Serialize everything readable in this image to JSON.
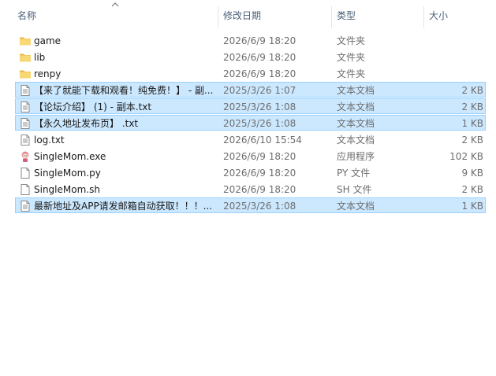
{
  "columns": {
    "name": "名称",
    "date": "修改日期",
    "type": "类型",
    "size": "大小"
  },
  "files": [
    {
      "name": "game",
      "date": "2026/6/9 18:20",
      "type": "文件夹",
      "size": "",
      "icon": "folder-icon",
      "selected": false
    },
    {
      "name": "lib",
      "date": "2026/6/9 18:20",
      "type": "文件夹",
      "size": "",
      "icon": "folder-icon",
      "selected": false
    },
    {
      "name": "renpy",
      "date": "2026/6/9 18:20",
      "type": "文件夹",
      "size": "",
      "icon": "folder-icon",
      "selected": false
    },
    {
      "name": "【来了就能下载和观看！纯免费！】 - 副...",
      "date": "2025/3/26 1:07",
      "type": "文本文档",
      "size": "2 KB",
      "icon": "text-file-icon",
      "selected": true
    },
    {
      "name": "【论坛介绍】 (1) - 副本.txt",
      "date": "2025/3/26 1:08",
      "type": "文本文档",
      "size": "2 KB",
      "icon": "text-file-icon",
      "selected": true
    },
    {
      "name": "【永久地址发布页】 .txt",
      "date": "2025/3/26 1:08",
      "type": "文本文档",
      "size": "1 KB",
      "icon": "text-file-icon",
      "selected": true
    },
    {
      "name": "log.txt",
      "date": "2026/6/10 15:54",
      "type": "文本文档",
      "size": "2 KB",
      "icon": "text-file-icon",
      "selected": false
    },
    {
      "name": "SingleMom.exe",
      "date": "2026/6/9 18:20",
      "type": "应用程序",
      "size": "102 KB",
      "icon": "renpy-app-icon",
      "selected": false
    },
    {
      "name": "SingleMom.py",
      "date": "2026/6/9 18:20",
      "type": "PY 文件",
      "size": "9 KB",
      "icon": "blank-file-icon",
      "selected": false
    },
    {
      "name": "SingleMom.sh",
      "date": "2026/6/9 18:20",
      "type": "SH 文件",
      "size": "2 KB",
      "icon": "blank-file-icon",
      "selected": false
    },
    {
      "name": "最新地址及APP请发邮箱自动获取！！！...",
      "date": "2025/3/26 1:08",
      "type": "文本文档",
      "size": "1 KB",
      "icon": "text-file-icon",
      "selected": true
    }
  ],
  "colors": {
    "selection_bg": "#cce8ff",
    "selection_border": "#99d1ff",
    "header_text": "#4c607a",
    "folder": "#f8d775"
  }
}
